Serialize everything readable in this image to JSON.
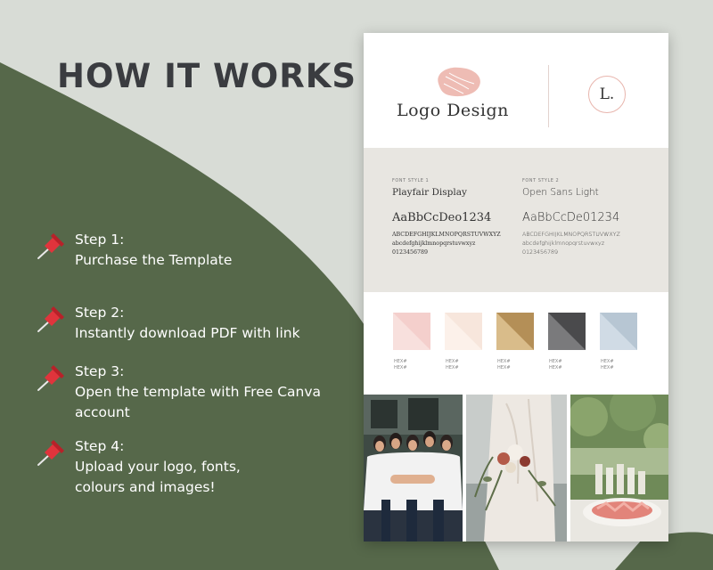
{
  "title": "HOW IT WORKS",
  "steps": [
    {
      "label": "Step 1:",
      "line1": "Purchase the Template",
      "line2": ""
    },
    {
      "label": "Step 2:",
      "line1": "Instantly download PDF with link",
      "line2": ""
    },
    {
      "label": "Step 3:",
      "line1": "Open the template with Free Canva",
      "line2": "account"
    },
    {
      "label": "Step 4:",
      "line1": "Upload your logo, fonts,",
      "line2": "colours and images!"
    }
  ],
  "icons": {
    "step": "pushpin-icon"
  },
  "colors": {
    "green": "#56684a",
    "background": "#d8dcd6",
    "pin": "#e0343c"
  },
  "brand_card": {
    "logo_text": "Logo Design",
    "monogram": "L.",
    "font_styles": [
      {
        "label": "FONT STYLE 1",
        "name": "Playfair Display",
        "sample": "AaBbCcDeo1234",
        "upper": "ABCDEFGHIJKLMNOPQRSTUVWXYZ",
        "lower": "abcdefghijklmnopqrstuvwxyz",
        "digits": "0123456789"
      },
      {
        "label": "FONT STYLE 2",
        "name": "Open Sans Light",
        "sample": "AaBbCcDe01234",
        "upper": "ABCDEFGHIJKLMNOPQRSTUVWXYZ",
        "lower": "abcdefghijklmnopqrstuvwxyz",
        "digits": "0123456789"
      }
    ],
    "palette": [
      {
        "color_a": "#f4cfcc",
        "color_b": "#f8e0dd",
        "hex1": "HEX#",
        "hex2": "HEX#"
      },
      {
        "color_a": "#f7e6dc",
        "color_b": "#fcf1ea",
        "hex1": "HEX#",
        "hex2": "HEX#"
      },
      {
        "color_a": "#b48f57",
        "color_b": "#d9bc8a",
        "hex1": "HEX#",
        "hex2": "HEX#"
      },
      {
        "color_a": "#4a4a4c",
        "color_b": "#7a7a7c",
        "hex1": "HEX#",
        "hex2": "HEX#"
      },
      {
        "color_a": "#b7c6d3",
        "color_b": "#d0dbe5",
        "hex1": "HEX#",
        "hex2": "HEX#"
      }
    ]
  }
}
